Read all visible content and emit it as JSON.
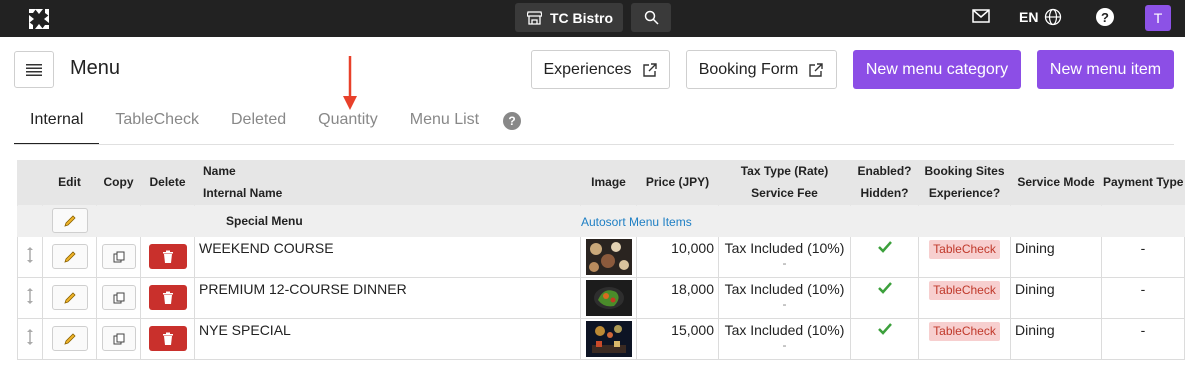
{
  "topbar": {
    "venue_name": "TC Bistro",
    "language": "EN",
    "help_label": "?",
    "avatar_initial": "T"
  },
  "header": {
    "title": "Menu",
    "experiences_label": "Experiences",
    "booking_form_label": "Booking Form",
    "new_category_label": "New menu category",
    "new_item_label": "New menu item",
    "accent_color": "#8c4ee6"
  },
  "tabs": [
    {
      "label": "Internal",
      "active": true
    },
    {
      "label": "TableCheck",
      "active": false
    },
    {
      "label": "Deleted",
      "active": false
    },
    {
      "label": "Quantity",
      "active": false
    },
    {
      "label": "Menu List",
      "active": false
    }
  ],
  "tab_help": "?",
  "table": {
    "headers": {
      "edit": "Edit",
      "copy": "Copy",
      "delete": "Delete",
      "name": "Name",
      "internal_name": "Internal Name",
      "image": "Image",
      "price": "Price (JPY)",
      "tax_type": "Tax Type (Rate)",
      "service_fee": "Service Fee",
      "enabled": "Enabled?",
      "hidden": "Hidden?",
      "booking_sites": "Booking Sites",
      "experience": "Experience?",
      "service_mode": "Service Mode",
      "payment_type": "Payment Type"
    },
    "category": {
      "name": "Special Menu",
      "autosort_label": "Autosort Menu Items"
    },
    "rows": [
      {
        "name": "WEEKEND COURSE",
        "price": "10,000",
        "tax": "Tax Included (10%)",
        "service_fee": "-",
        "booking_site": "TableCheck",
        "service_mode": "Dining",
        "payment_type": "-"
      },
      {
        "name": "PREMIUM 12-COURSE DINNER",
        "price": "18,000",
        "tax": "Tax Included (10%)",
        "service_fee": "-",
        "booking_site": "TableCheck",
        "service_mode": "Dining",
        "payment_type": "-"
      },
      {
        "name": "NYE SPECIAL",
        "price": "15,000",
        "tax": "Tax Included (10%)",
        "service_fee": "-",
        "booking_site": "TableCheck",
        "service_mode": "Dining",
        "payment_type": "-"
      }
    ]
  }
}
